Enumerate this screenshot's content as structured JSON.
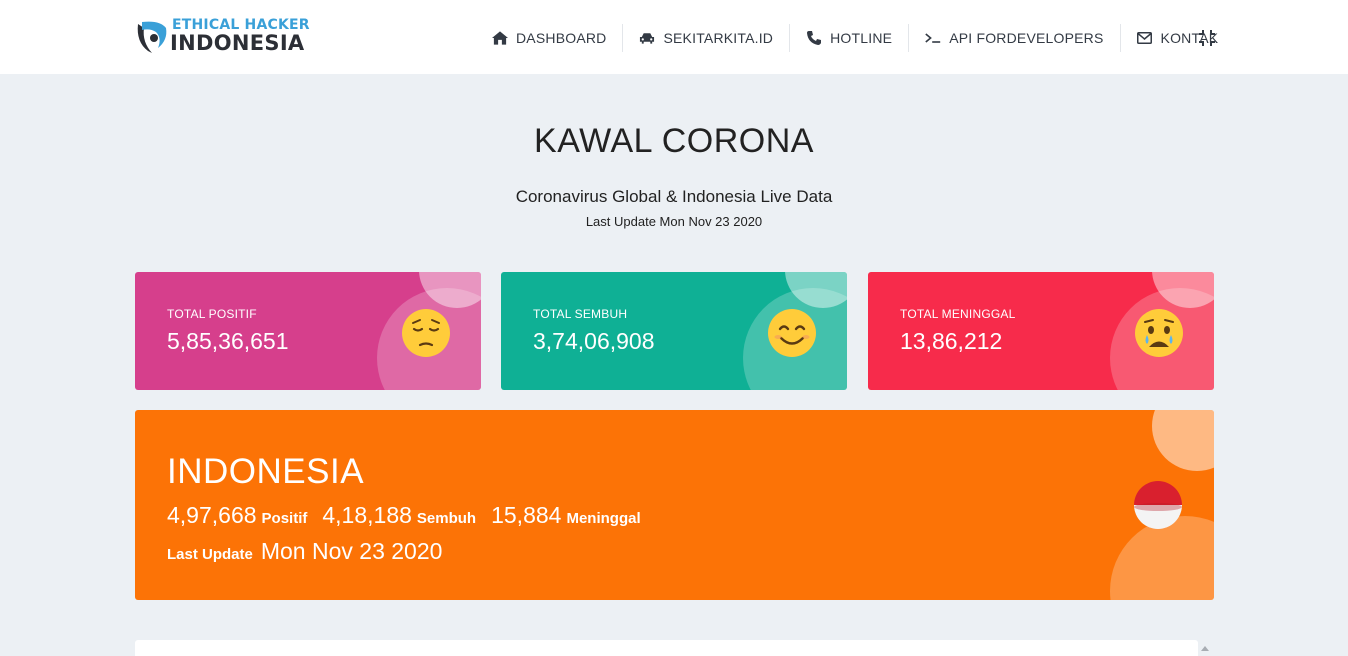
{
  "brand": {
    "line1": "ETHICAL HACKER",
    "line2": "INDONESIA",
    "colors": {
      "blue": "#3aa0d8",
      "dark": "#2c2f36"
    }
  },
  "nav": {
    "items": [
      {
        "label": "DASHBOARD",
        "icon": "home-icon"
      },
      {
        "label": "SEKITARKITA.ID",
        "icon": "car-icon"
      },
      {
        "label": "HOTLINE",
        "icon": "phone-icon"
      },
      {
        "label": "API FORDEVELOPERS",
        "icon": "terminal-icon"
      },
      {
        "label": "KONTAK",
        "icon": "envelope-icon"
      }
    ],
    "fullscreen_icon": "compress-icon"
  },
  "header": {
    "title": "KAWAL CORONA",
    "subtitle": "Coronavirus Global & Indonesia Live Data",
    "last_update": "Last Update Mon Nov 23 2020"
  },
  "global": {
    "positif": {
      "label": "TOTAL POSITIF",
      "value": "5,85,36,651",
      "emoji": "pensive-face-icon",
      "color": "#d63f8c"
    },
    "sembuh": {
      "label": "TOTAL SEMBUH",
      "value": "3,74,06,908",
      "emoji": "smiling-face-icon",
      "color": "#0fb095"
    },
    "meninggal": {
      "label": "TOTAL MENINGGAL",
      "value": "13,86,212",
      "emoji": "crying-face-icon",
      "color": "#f72b4b"
    }
  },
  "indonesia": {
    "title": "INDONESIA",
    "positif": {
      "value": "4,97,668",
      "label": "Positif"
    },
    "sembuh": {
      "value": "4,18,188",
      "label": "Sembuh"
    },
    "meninggal": {
      "value": "15,884",
      "label": "Meninggal"
    },
    "update_label": "Last Update",
    "update_value": "Mon Nov 23 2020",
    "flag_icon": "indonesia-flag-icon",
    "color": "#fc7306"
  }
}
